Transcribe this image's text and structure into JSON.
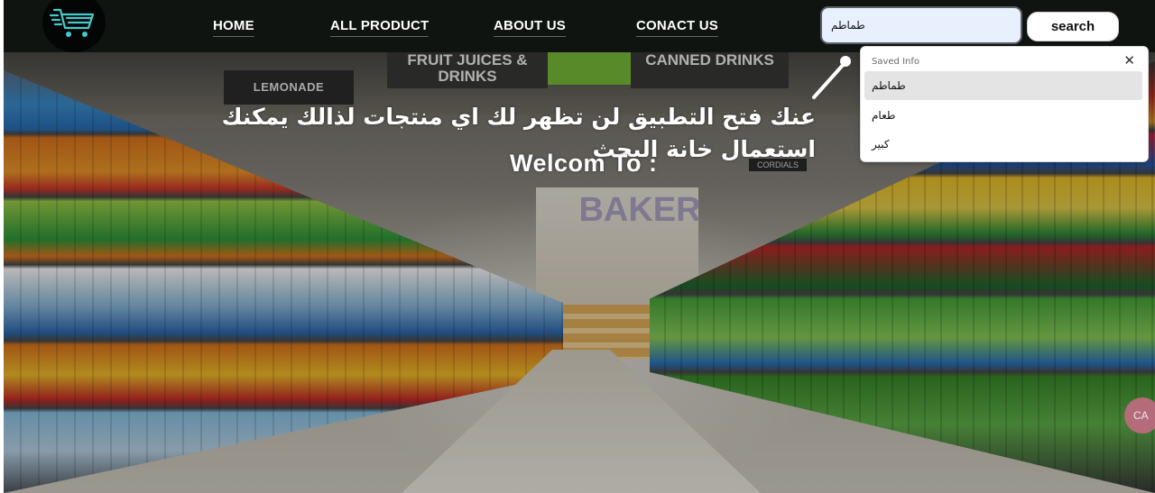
{
  "app": {
    "logo_icon": "shopping-cart-icon"
  },
  "nav": {
    "items": [
      {
        "label": "HOME"
      },
      {
        "label": "ALL PRODUCT"
      },
      {
        "label": "ABOUT US"
      },
      {
        "label": "CONACT US"
      }
    ]
  },
  "search": {
    "value": "طماطم",
    "button_label": "search"
  },
  "autocomplete": {
    "header": "Saved Info",
    "close_icon": "close-icon",
    "items": [
      {
        "label": "طماطم",
        "selected": true
      },
      {
        "label": "طعام",
        "selected": false
      },
      {
        "label": "كبير",
        "selected": false
      }
    ]
  },
  "hero": {
    "hint_text": "عنك فتح التطبيق لن تظهر لك اي منتجات لذالك يمكنك استعمال خانة البحث",
    "welcome_text": "Welcom To :",
    "signs": {
      "juices": "FRUIT JUICES & DRINKS",
      "canned": "CANNED DRINKS",
      "lemonade": "LEMONADE",
      "bakery": "BAKER",
      "cordials": "CORDIALS"
    }
  },
  "colors": {
    "navbar_bg": "#0f1411",
    "search_input_bg": "#e8f0fe",
    "logo_accent": "#48c9c9"
  }
}
